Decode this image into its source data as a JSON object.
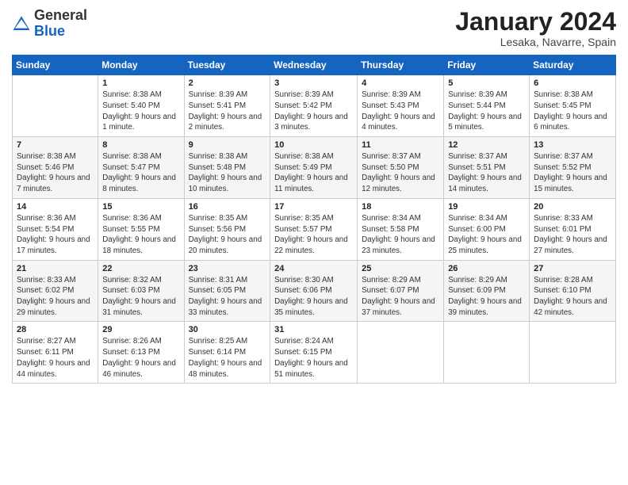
{
  "header": {
    "logo": {
      "general": "General",
      "blue": "Blue"
    },
    "title": "January 2024",
    "location": "Lesaka, Navarre, Spain"
  },
  "calendar": {
    "days_of_week": [
      "Sunday",
      "Monday",
      "Tuesday",
      "Wednesday",
      "Thursday",
      "Friday",
      "Saturday"
    ],
    "weeks": [
      [
        {
          "day": "",
          "sunrise": "",
          "sunset": "",
          "daylight": ""
        },
        {
          "day": "1",
          "sunrise": "Sunrise: 8:38 AM",
          "sunset": "Sunset: 5:40 PM",
          "daylight": "Daylight: 9 hours and 1 minute."
        },
        {
          "day": "2",
          "sunrise": "Sunrise: 8:39 AM",
          "sunset": "Sunset: 5:41 PM",
          "daylight": "Daylight: 9 hours and 2 minutes."
        },
        {
          "day": "3",
          "sunrise": "Sunrise: 8:39 AM",
          "sunset": "Sunset: 5:42 PM",
          "daylight": "Daylight: 9 hours and 3 minutes."
        },
        {
          "day": "4",
          "sunrise": "Sunrise: 8:39 AM",
          "sunset": "Sunset: 5:43 PM",
          "daylight": "Daylight: 9 hours and 4 minutes."
        },
        {
          "day": "5",
          "sunrise": "Sunrise: 8:39 AM",
          "sunset": "Sunset: 5:44 PM",
          "daylight": "Daylight: 9 hours and 5 minutes."
        },
        {
          "day": "6",
          "sunrise": "Sunrise: 8:38 AM",
          "sunset": "Sunset: 5:45 PM",
          "daylight": "Daylight: 9 hours and 6 minutes."
        }
      ],
      [
        {
          "day": "7",
          "sunrise": "Sunrise: 8:38 AM",
          "sunset": "Sunset: 5:46 PM",
          "daylight": "Daylight: 9 hours and 7 minutes."
        },
        {
          "day": "8",
          "sunrise": "Sunrise: 8:38 AM",
          "sunset": "Sunset: 5:47 PM",
          "daylight": "Daylight: 9 hours and 8 minutes."
        },
        {
          "day": "9",
          "sunrise": "Sunrise: 8:38 AM",
          "sunset": "Sunset: 5:48 PM",
          "daylight": "Daylight: 9 hours and 10 minutes."
        },
        {
          "day": "10",
          "sunrise": "Sunrise: 8:38 AM",
          "sunset": "Sunset: 5:49 PM",
          "daylight": "Daylight: 9 hours and 11 minutes."
        },
        {
          "day": "11",
          "sunrise": "Sunrise: 8:37 AM",
          "sunset": "Sunset: 5:50 PM",
          "daylight": "Daylight: 9 hours and 12 minutes."
        },
        {
          "day": "12",
          "sunrise": "Sunrise: 8:37 AM",
          "sunset": "Sunset: 5:51 PM",
          "daylight": "Daylight: 9 hours and 14 minutes."
        },
        {
          "day": "13",
          "sunrise": "Sunrise: 8:37 AM",
          "sunset": "Sunset: 5:52 PM",
          "daylight": "Daylight: 9 hours and 15 minutes."
        }
      ],
      [
        {
          "day": "14",
          "sunrise": "Sunrise: 8:36 AM",
          "sunset": "Sunset: 5:54 PM",
          "daylight": "Daylight: 9 hours and 17 minutes."
        },
        {
          "day": "15",
          "sunrise": "Sunrise: 8:36 AM",
          "sunset": "Sunset: 5:55 PM",
          "daylight": "Daylight: 9 hours and 18 minutes."
        },
        {
          "day": "16",
          "sunrise": "Sunrise: 8:35 AM",
          "sunset": "Sunset: 5:56 PM",
          "daylight": "Daylight: 9 hours and 20 minutes."
        },
        {
          "day": "17",
          "sunrise": "Sunrise: 8:35 AM",
          "sunset": "Sunset: 5:57 PM",
          "daylight": "Daylight: 9 hours and 22 minutes."
        },
        {
          "day": "18",
          "sunrise": "Sunrise: 8:34 AM",
          "sunset": "Sunset: 5:58 PM",
          "daylight": "Daylight: 9 hours and 23 minutes."
        },
        {
          "day": "19",
          "sunrise": "Sunrise: 8:34 AM",
          "sunset": "Sunset: 6:00 PM",
          "daylight": "Daylight: 9 hours and 25 minutes."
        },
        {
          "day": "20",
          "sunrise": "Sunrise: 8:33 AM",
          "sunset": "Sunset: 6:01 PM",
          "daylight": "Daylight: 9 hours and 27 minutes."
        }
      ],
      [
        {
          "day": "21",
          "sunrise": "Sunrise: 8:33 AM",
          "sunset": "Sunset: 6:02 PM",
          "daylight": "Daylight: 9 hours and 29 minutes."
        },
        {
          "day": "22",
          "sunrise": "Sunrise: 8:32 AM",
          "sunset": "Sunset: 6:03 PM",
          "daylight": "Daylight: 9 hours and 31 minutes."
        },
        {
          "day": "23",
          "sunrise": "Sunrise: 8:31 AM",
          "sunset": "Sunset: 6:05 PM",
          "daylight": "Daylight: 9 hours and 33 minutes."
        },
        {
          "day": "24",
          "sunrise": "Sunrise: 8:30 AM",
          "sunset": "Sunset: 6:06 PM",
          "daylight": "Daylight: 9 hours and 35 minutes."
        },
        {
          "day": "25",
          "sunrise": "Sunrise: 8:29 AM",
          "sunset": "Sunset: 6:07 PM",
          "daylight": "Daylight: 9 hours and 37 minutes."
        },
        {
          "day": "26",
          "sunrise": "Sunrise: 8:29 AM",
          "sunset": "Sunset: 6:09 PM",
          "daylight": "Daylight: 9 hours and 39 minutes."
        },
        {
          "day": "27",
          "sunrise": "Sunrise: 8:28 AM",
          "sunset": "Sunset: 6:10 PM",
          "daylight": "Daylight: 9 hours and 42 minutes."
        }
      ],
      [
        {
          "day": "28",
          "sunrise": "Sunrise: 8:27 AM",
          "sunset": "Sunset: 6:11 PM",
          "daylight": "Daylight: 9 hours and 44 minutes."
        },
        {
          "day": "29",
          "sunrise": "Sunrise: 8:26 AM",
          "sunset": "Sunset: 6:13 PM",
          "daylight": "Daylight: 9 hours and 46 minutes."
        },
        {
          "day": "30",
          "sunrise": "Sunrise: 8:25 AM",
          "sunset": "Sunset: 6:14 PM",
          "daylight": "Daylight: 9 hours and 48 minutes."
        },
        {
          "day": "31",
          "sunrise": "Sunrise: 8:24 AM",
          "sunset": "Sunset: 6:15 PM",
          "daylight": "Daylight: 9 hours and 51 minutes."
        },
        {
          "day": "",
          "sunrise": "",
          "sunset": "",
          "daylight": ""
        },
        {
          "day": "",
          "sunrise": "",
          "sunset": "",
          "daylight": ""
        },
        {
          "day": "",
          "sunrise": "",
          "sunset": "",
          "daylight": ""
        }
      ]
    ]
  }
}
